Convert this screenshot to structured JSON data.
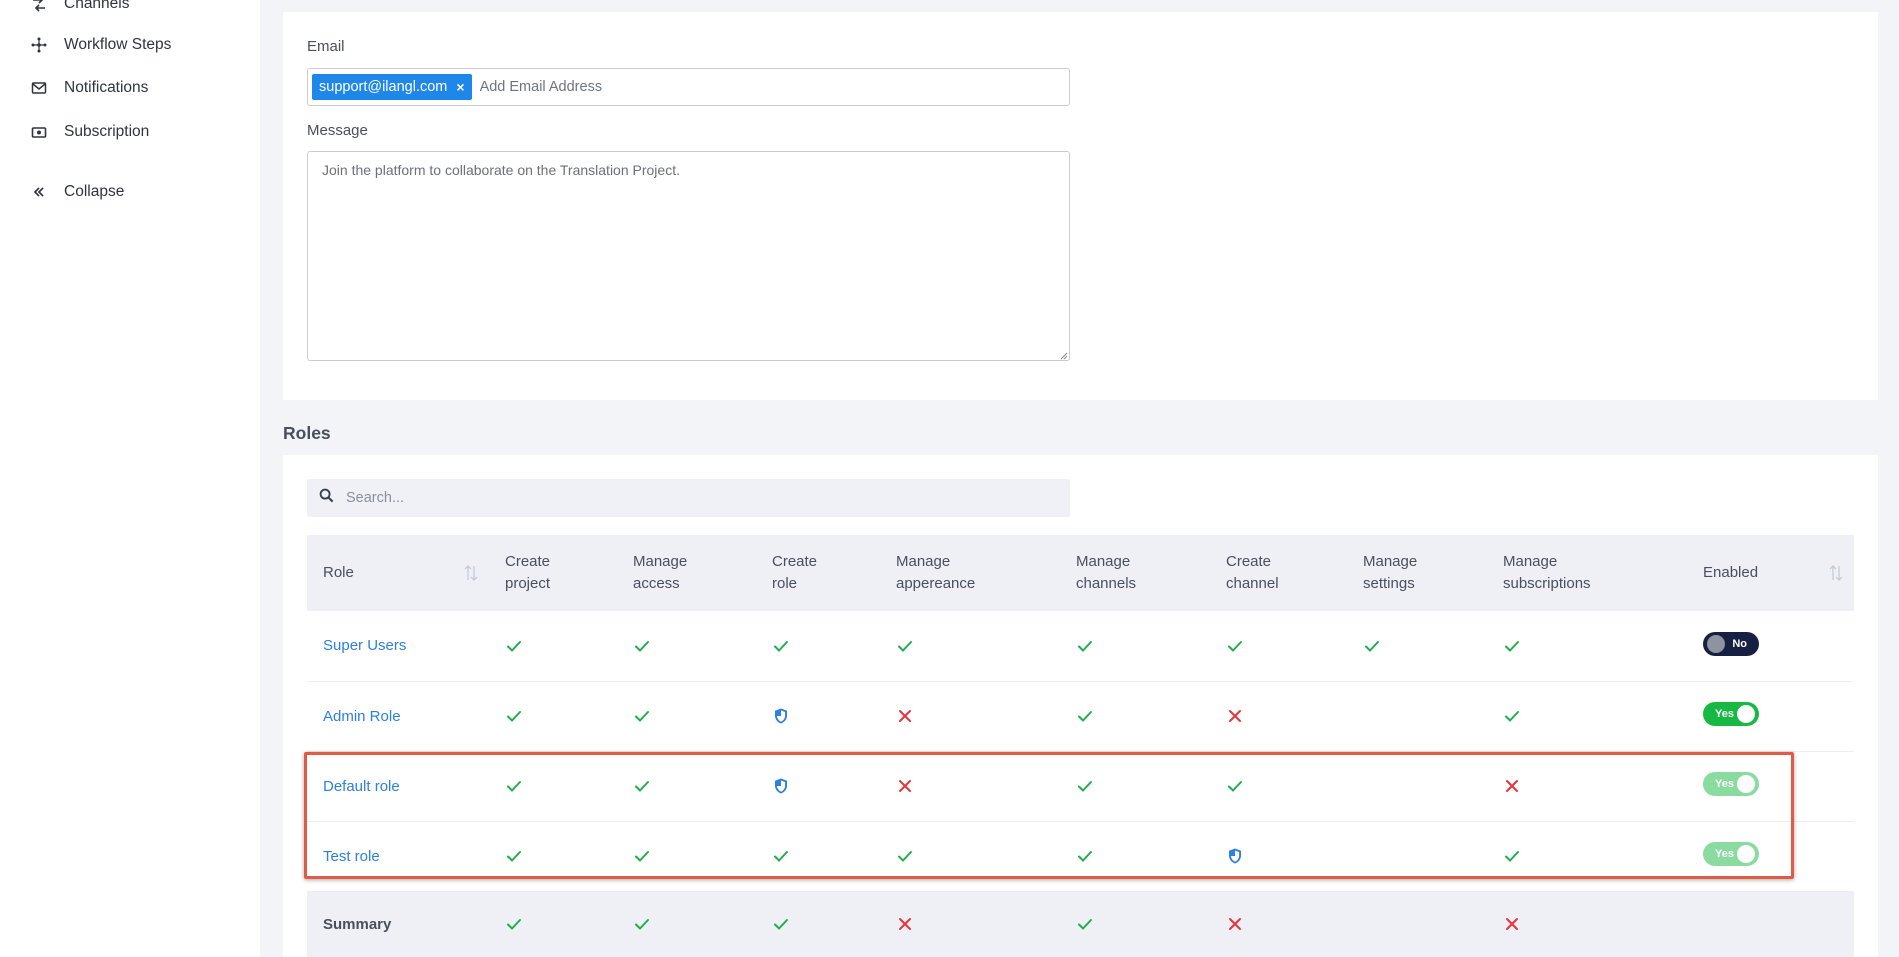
{
  "sidebar": {
    "items": [
      {
        "label": "Channels",
        "icon": "channels-icon"
      },
      {
        "label": "Workflow Steps",
        "icon": "workflow-icon"
      },
      {
        "label": "Notifications",
        "icon": "mail-icon"
      },
      {
        "label": "Subscription",
        "icon": "subscription-icon"
      },
      {
        "label": "Collapse",
        "icon": "double-chevron-left-icon"
      }
    ]
  },
  "invite": {
    "email_label": "Email",
    "email_chip": "support@ilangl.com",
    "email_chip_remove": "×",
    "email_placeholder": "Add Email Address",
    "message_label": "Message",
    "message_value": "Join the platform to collaborate on the Translation Project."
  },
  "roles": {
    "section_title": "Roles",
    "search_placeholder": "Search...",
    "columns": [
      "Role",
      "Create project",
      "Manage access",
      "Create role",
      "Manage appereance",
      "Manage channels",
      "Create channel",
      "Manage settings",
      "Manage subscriptions",
      "Enabled"
    ],
    "column_lines": [
      [
        "Role",
        ""
      ],
      [
        "Create",
        "project"
      ],
      [
        "Manage",
        "access"
      ],
      [
        "Create",
        "role"
      ],
      [
        "Manage",
        "appereance"
      ],
      [
        "Manage",
        "channels"
      ],
      [
        "Create",
        "channel"
      ],
      [
        "Manage",
        "settings"
      ],
      [
        "Manage",
        "subscriptions"
      ],
      [
        "Enabled",
        ""
      ]
    ],
    "rows": [
      {
        "name": "Super Users",
        "perms": [
          "check",
          "check",
          "check",
          "check",
          "check",
          "check",
          "check",
          "check"
        ],
        "enabled": false,
        "enabled_label": "No",
        "highlighted": false
      },
      {
        "name": "Admin Role",
        "perms": [
          "check",
          "check",
          "shield",
          "cross",
          "check",
          "cross",
          "none",
          "check"
        ],
        "enabled": true,
        "enabled_label": "Yes",
        "highlighted": false
      },
      {
        "name": "Default role",
        "perms": [
          "check",
          "check",
          "shield",
          "cross",
          "check",
          "check",
          "none",
          "cross"
        ],
        "enabled": true,
        "enabled_label": "Yes",
        "highlighted": true
      },
      {
        "name": "Test role",
        "perms": [
          "check",
          "check",
          "check",
          "check",
          "check",
          "shield",
          "none",
          "check"
        ],
        "enabled": true,
        "enabled_label": "Yes",
        "highlighted": true
      }
    ],
    "summary": {
      "label": "Summary",
      "perms": [
        "check",
        "check",
        "check",
        "cross",
        "check",
        "cross",
        "none",
        "cross"
      ]
    }
  },
  "colors": {
    "check": "#1fae4a",
    "cross": "#e8323c",
    "shield": "#2d7fe0",
    "link": "#2d7fe0",
    "chip": "#1f86ea",
    "toggle_no": "#172042",
    "toggle_yes": "#17b843",
    "highlight": "#e05a44"
  }
}
